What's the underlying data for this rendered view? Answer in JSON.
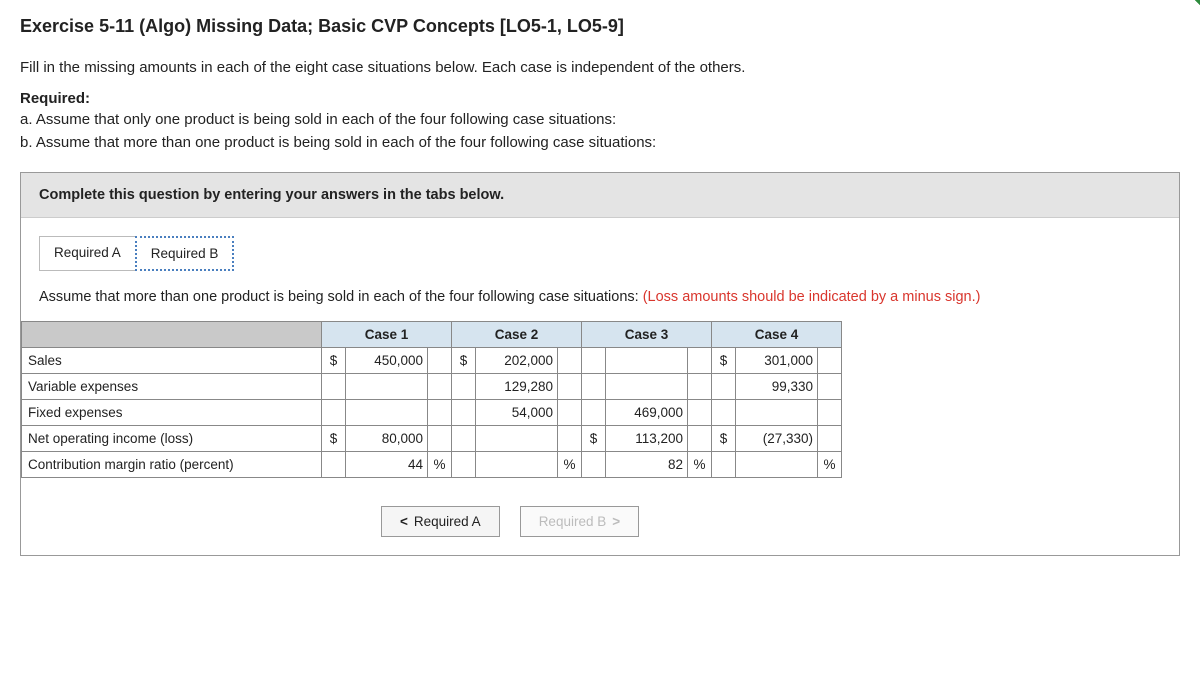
{
  "title": "Exercise 5-11 (Algo) Missing Data; Basic CVP Concepts [LO5-1, LO5-9]",
  "intro": "Fill in the missing amounts in each of the eight case situations below. Each case is independent of the others.",
  "required_heading": "Required:",
  "required_a": "a. Assume that only one product is being sold in each of the four following case situations:",
  "required_b": "b. Assume that more than one product is being sold in each of the four following case situations:",
  "instruction_bar": "Complete this question by entering your answers in the tabs below.",
  "tabs": {
    "a": "Required A",
    "b": "Required B"
  },
  "assume_text": "Assume that more than one product is being sold in each of the four following case situations: ",
  "loss_note": "(Loss amounts should be indicated by a minus sign.)",
  "headers": {
    "c1": "Case 1",
    "c2": "Case 2",
    "c3": "Case 3",
    "c4": "Case 4"
  },
  "rows": {
    "sales": "Sales",
    "varexp": "Variable expenses",
    "fixed": "Fixed expenses",
    "noi": "Net operating income (loss)",
    "cmr": "Contribution margin ratio (percent)"
  },
  "symbols": {
    "dollar": "$",
    "percent": "%"
  },
  "values": {
    "sales": {
      "c1": "450,000",
      "c2": "202,000",
      "c3": "",
      "c4": "301,000"
    },
    "varexp": {
      "c1": "",
      "c2": "129,280",
      "c3": "",
      "c4": "99,330"
    },
    "fixed": {
      "c1": "",
      "c2": "54,000",
      "c3": "469,000",
      "c4": ""
    },
    "noi": {
      "c1": "80,000",
      "c2": "",
      "c3": "113,200",
      "c4": "(27,330)"
    },
    "cmr": {
      "c1": "44",
      "c2": "",
      "c3": "82",
      "c4": ""
    }
  },
  "nav": {
    "prev": "Required A",
    "next": "Required B"
  }
}
